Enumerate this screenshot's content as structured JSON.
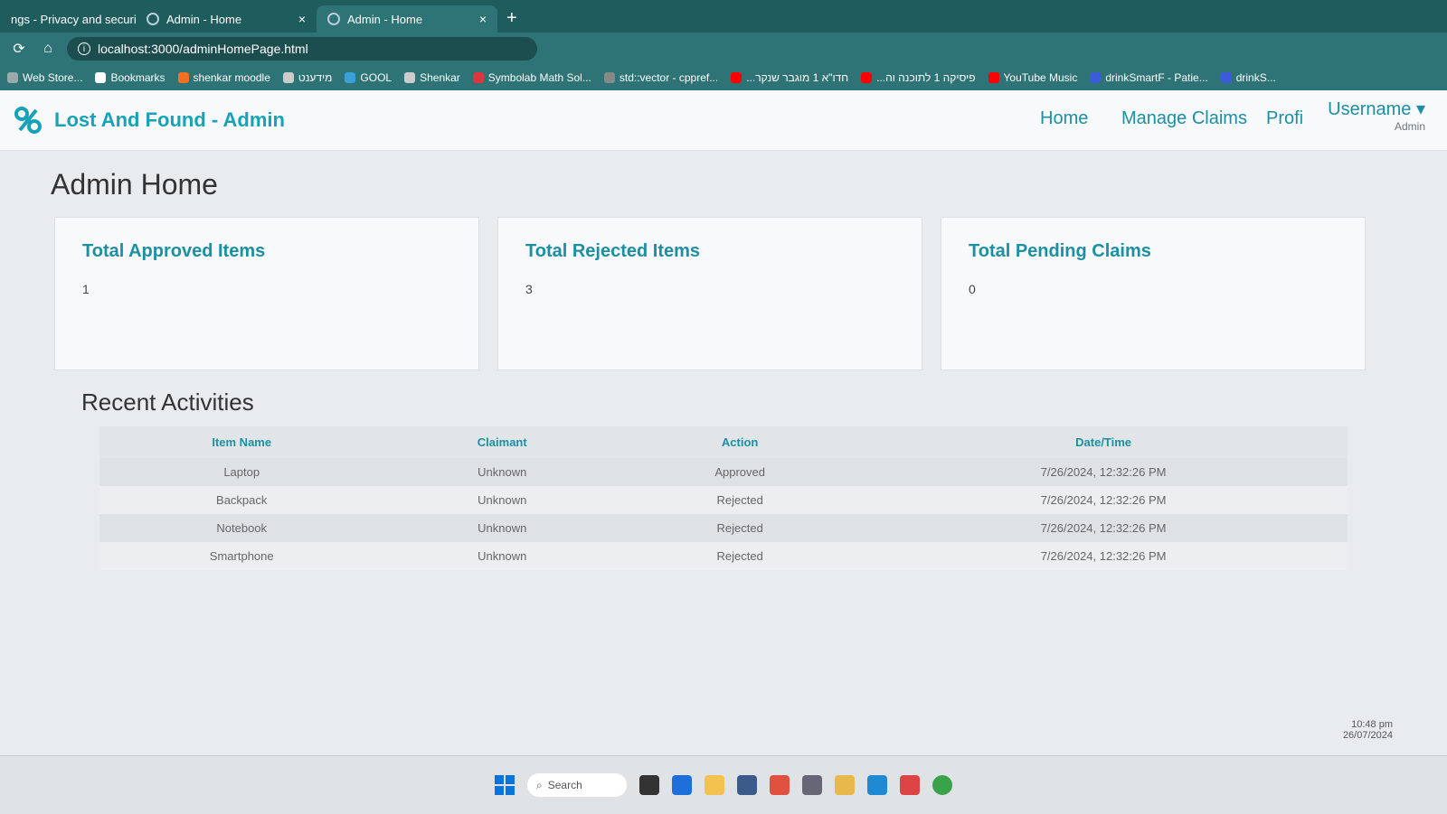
{
  "browser": {
    "tabs": [
      {
        "label": "ngs - Privacy and security",
        "active": false
      },
      {
        "label": "Admin - Home",
        "active": false
      },
      {
        "label": "Admin - Home",
        "active": true
      }
    ],
    "new_tab_label": "+",
    "close_label": "×",
    "address": "localhost:3000/adminHomePage.html",
    "bookmarks": [
      {
        "label": "Web Store...",
        "icon": "store-icon",
        "color": "#9aa"
      },
      {
        "label": "Bookmarks",
        "icon": "star-icon",
        "color": "#fff"
      },
      {
        "label": "shenkar moodle",
        "icon": "moodle-icon",
        "color": "#f36f21"
      },
      {
        "label": "מידענט",
        "icon": "globe-icon",
        "color": "#ccc"
      },
      {
        "label": "GOOL",
        "icon": "gool-icon",
        "color": "#3aa0d8"
      },
      {
        "label": "Shenkar",
        "icon": "globe-icon",
        "color": "#ccc"
      },
      {
        "label": "Symbolab Math Sol...",
        "icon": "symbolab-icon",
        "color": "#d9363e"
      },
      {
        "label": "std::vector - cppref...",
        "icon": "cpp-icon",
        "color": "#888"
      },
      {
        "label": "...חדו\"א 1 מוגבר שנקר",
        "icon": "youtube-icon",
        "color": "#ff0000"
      },
      {
        "label": "...פיסיקה 1 לתוכנה וה",
        "icon": "youtube-icon",
        "color": "#ff0000"
      },
      {
        "label": "YouTube Music",
        "icon": "ytmusic-icon",
        "color": "#ff0000"
      },
      {
        "label": "drinkSmartF - Patie...",
        "icon": "m-icon",
        "color": "#3b5bdb"
      },
      {
        "label": "drinkS...",
        "icon": "m-icon",
        "color": "#3b5bdb"
      }
    ]
  },
  "navbar": {
    "brand": "Lost And Found - Admin",
    "links": [
      {
        "label": "Home"
      },
      {
        "label": "Manage Claims"
      },
      {
        "label": "Profi"
      }
    ],
    "username": "Username ▾",
    "role": "Admin"
  },
  "main": {
    "title": "Admin Home",
    "cards": [
      {
        "title": "Total Approved Items",
        "value": "1"
      },
      {
        "title": "Total Rejected Items",
        "value": "3"
      },
      {
        "title": "Total Pending Claims",
        "value": "0"
      }
    ],
    "recent_title": "Recent Activities",
    "table": {
      "headers": [
        "Item Name",
        "Claimant",
        "Action",
        "Date/Time"
      ],
      "rows": [
        [
          "Laptop",
          "Unknown",
          "Approved",
          "7/26/2024, 12:32:26 PM"
        ],
        [
          "Backpack",
          "Unknown",
          "Rejected",
          "7/26/2024, 12:32:26 PM"
        ],
        [
          "Notebook",
          "Unknown",
          "Rejected",
          "7/26/2024, 12:32:26 PM"
        ],
        [
          "Smartphone",
          "Unknown",
          "Rejected",
          "7/26/2024, 12:32:26 PM"
        ]
      ]
    }
  },
  "system": {
    "time": "10:48 pm",
    "date": "26/07/2024",
    "search": "Search"
  }
}
